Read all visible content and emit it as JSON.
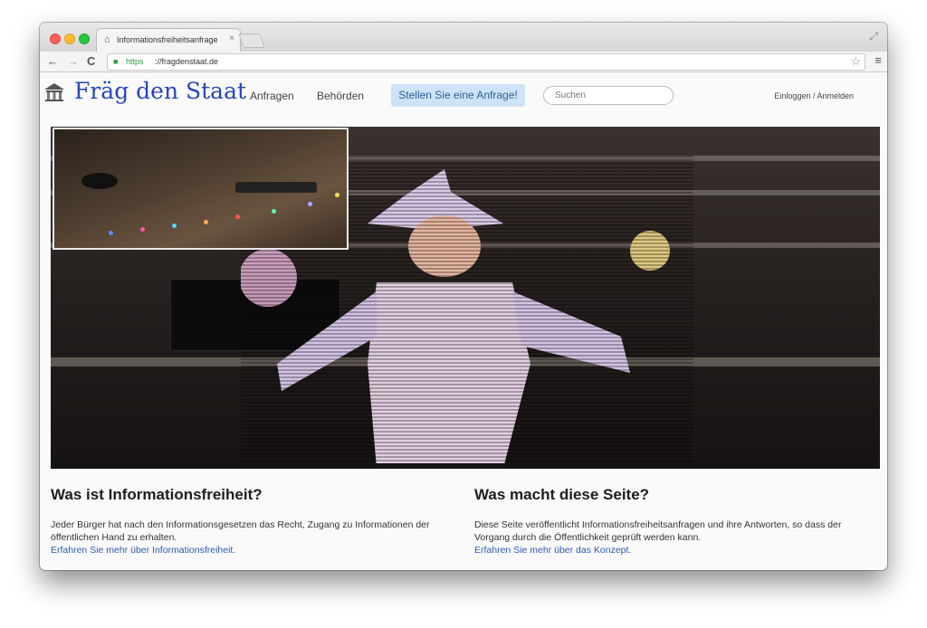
{
  "browser": {
    "tab_title": "Informationsfreiheitsanfrage",
    "tab_close": "×",
    "url_scheme": "https",
    "url_rest": "://fragdenstaat.de",
    "star": "☆",
    "menu": "≡",
    "back": "←",
    "forward": "→",
    "reload": "C"
  },
  "site": {
    "logo_text": "Fräg den Staat",
    "nav": {
      "anfragen": "Anfragen",
      "behoerden": "Behörden",
      "cta": "Stellen Sie eine Anfrage!"
    },
    "search_placeholder": "Suchen",
    "login": "Einloggen / Anmelden"
  },
  "left": {
    "heading": "Was ist Informationsfreiheit?",
    "body": "Jeder Bürger hat nach den Informationsgesetzen das Recht, Zugang zu Informationen der öffentlichen Hand zu erhalten.",
    "link": "Erfahren Sie mehr über Informationsfreiheit."
  },
  "right": {
    "heading": "Was macht diese Seite?",
    "body": "Diese Seite veröffentlicht Informationsfreiheitsanfragen und ihre Antworten, so dass der Vorgang durch die Öffentlichkeit geprüft werden kann.",
    "link": "Erfahren Sie mehr über das Konzept."
  },
  "colors": {
    "logo": "#2845bd",
    "cta_bg": "#cfe3f8",
    "link": "#2a5ab8"
  }
}
